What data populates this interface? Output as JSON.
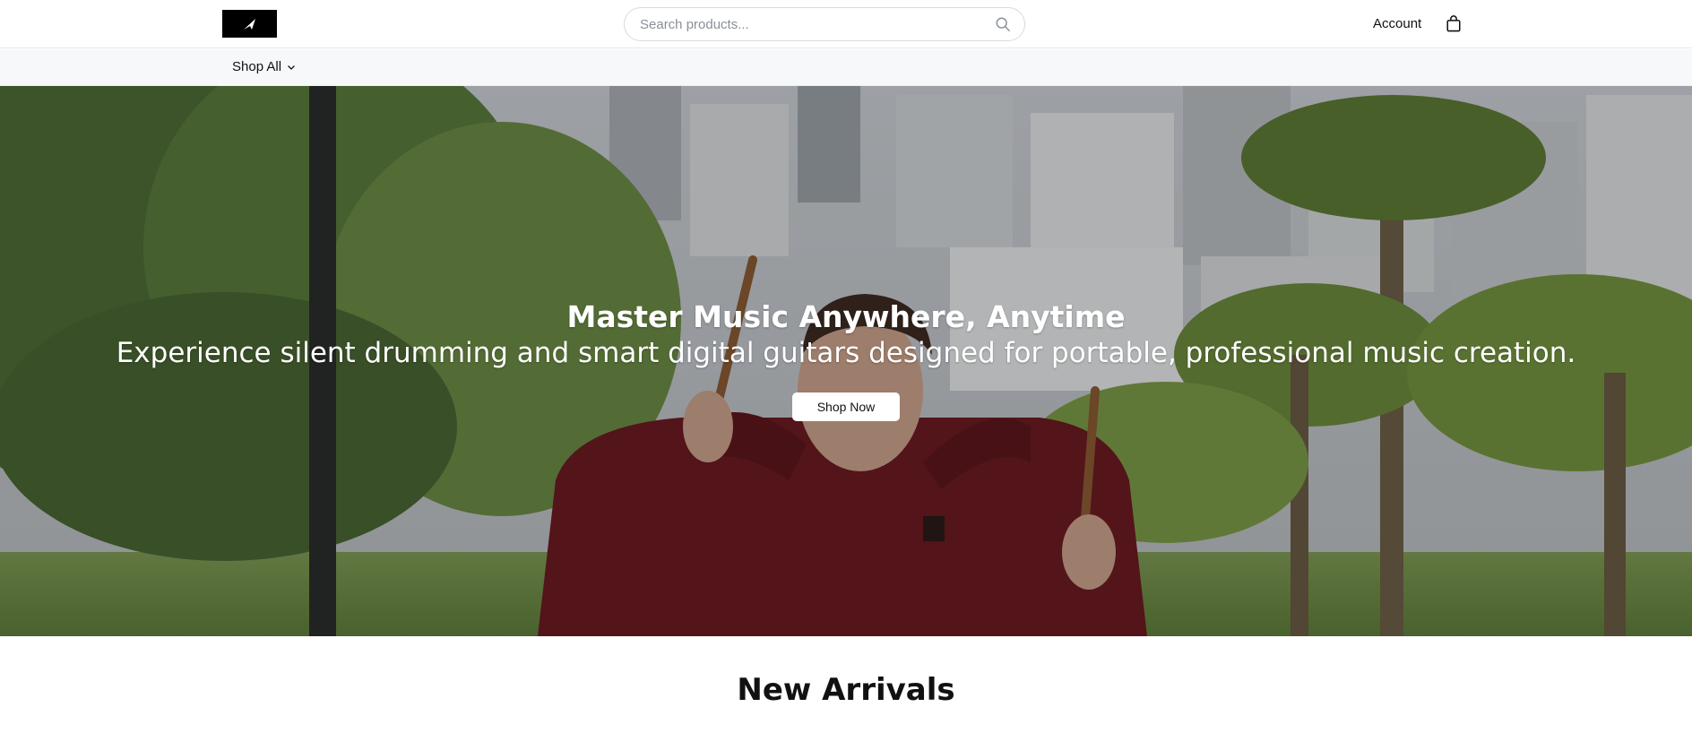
{
  "header": {
    "logo_name": "store-logo",
    "search": {
      "placeholder": "Search products...",
      "value": ""
    },
    "account_label": "Account",
    "cart_icon": "shopping-bag-icon"
  },
  "nav": {
    "shop_all_label": "Shop All",
    "shop_all_icon": "chevron-down-icon"
  },
  "hero": {
    "title": "Master Music Anywhere, Anytime",
    "subtitle": "Experience silent drumming and smart digital guitars designed for portable, professional music creation.",
    "cta_label": "Shop Now"
  },
  "sections": {
    "new_arrivals_title": "New Arrivals"
  },
  "colors": {
    "header_bg": "#ffffff",
    "nav_bg": "#f7f8fa",
    "logo_bg": "#000000",
    "hoodie": "#6b1a22",
    "text": "#111111"
  }
}
